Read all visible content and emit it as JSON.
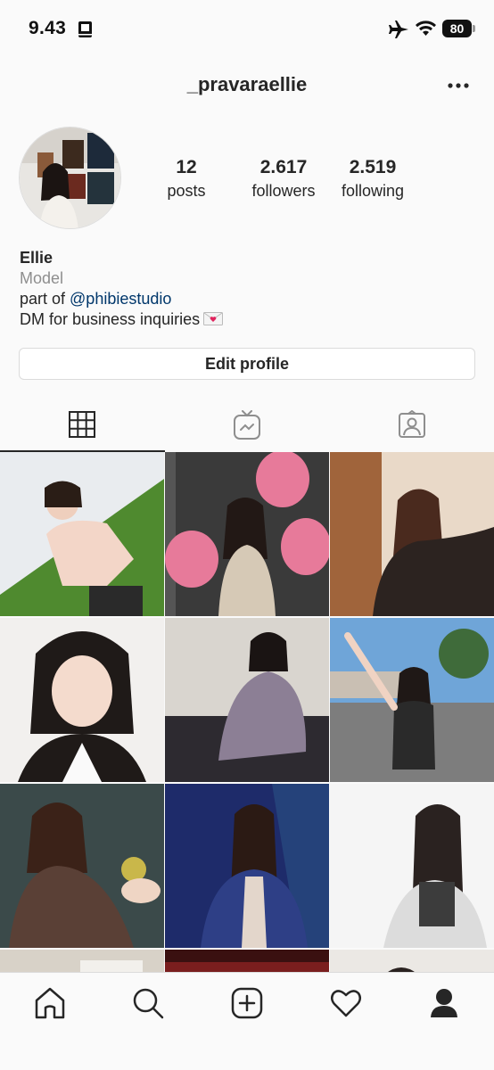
{
  "status_bar": {
    "time": "9.43",
    "battery": "80"
  },
  "header": {
    "username": "_pravaraellie"
  },
  "profile": {
    "stats": [
      {
        "value": "12",
        "label": "posts"
      },
      {
        "value": "2.617",
        "label": "followers"
      },
      {
        "value": "2.519",
        "label": "following"
      }
    ],
    "name": "Ellie",
    "category": "Model",
    "bio_prefix": "part of ",
    "bio_mention": "@phibiestudio",
    "bio_line2": "DM for business inquiries",
    "edit_label": "Edit profile"
  },
  "tabs": [
    {
      "icon": "grid-icon",
      "active": true
    },
    {
      "icon": "igtv-icon",
      "active": false
    },
    {
      "icon": "tagged-icon",
      "active": false
    }
  ],
  "grid_colors": [
    [
      "#e9ecef",
      "#4f8a2f",
      "#f3d6c8"
    ],
    [
      "#3a3a3a",
      "#e77a9a",
      "#d6c9b6"
    ],
    [
      "#a0643b",
      "#2c2320",
      "#e9d9c8"
    ],
    [
      "#f2f0ee",
      "#1f1a18",
      "#fafafa"
    ],
    [
      "#d9d5cf",
      "#8c7f95",
      "#2d2a30"
    ],
    [
      "#6fa5d8",
      "#2a2a2a",
      "#7d7d7d"
    ],
    [
      "#3b4a4a",
      "#5a4036",
      "#efd5c4"
    ],
    [
      "#1e2b6a",
      "#2e3f86",
      "#e3d6cb"
    ],
    [
      "#f5f5f5",
      "#dcdcdc",
      "#3c3c3c"
    ]
  ],
  "nav": [
    "home-icon",
    "search-icon",
    "new-post-icon",
    "activity-icon",
    "profile-icon"
  ]
}
